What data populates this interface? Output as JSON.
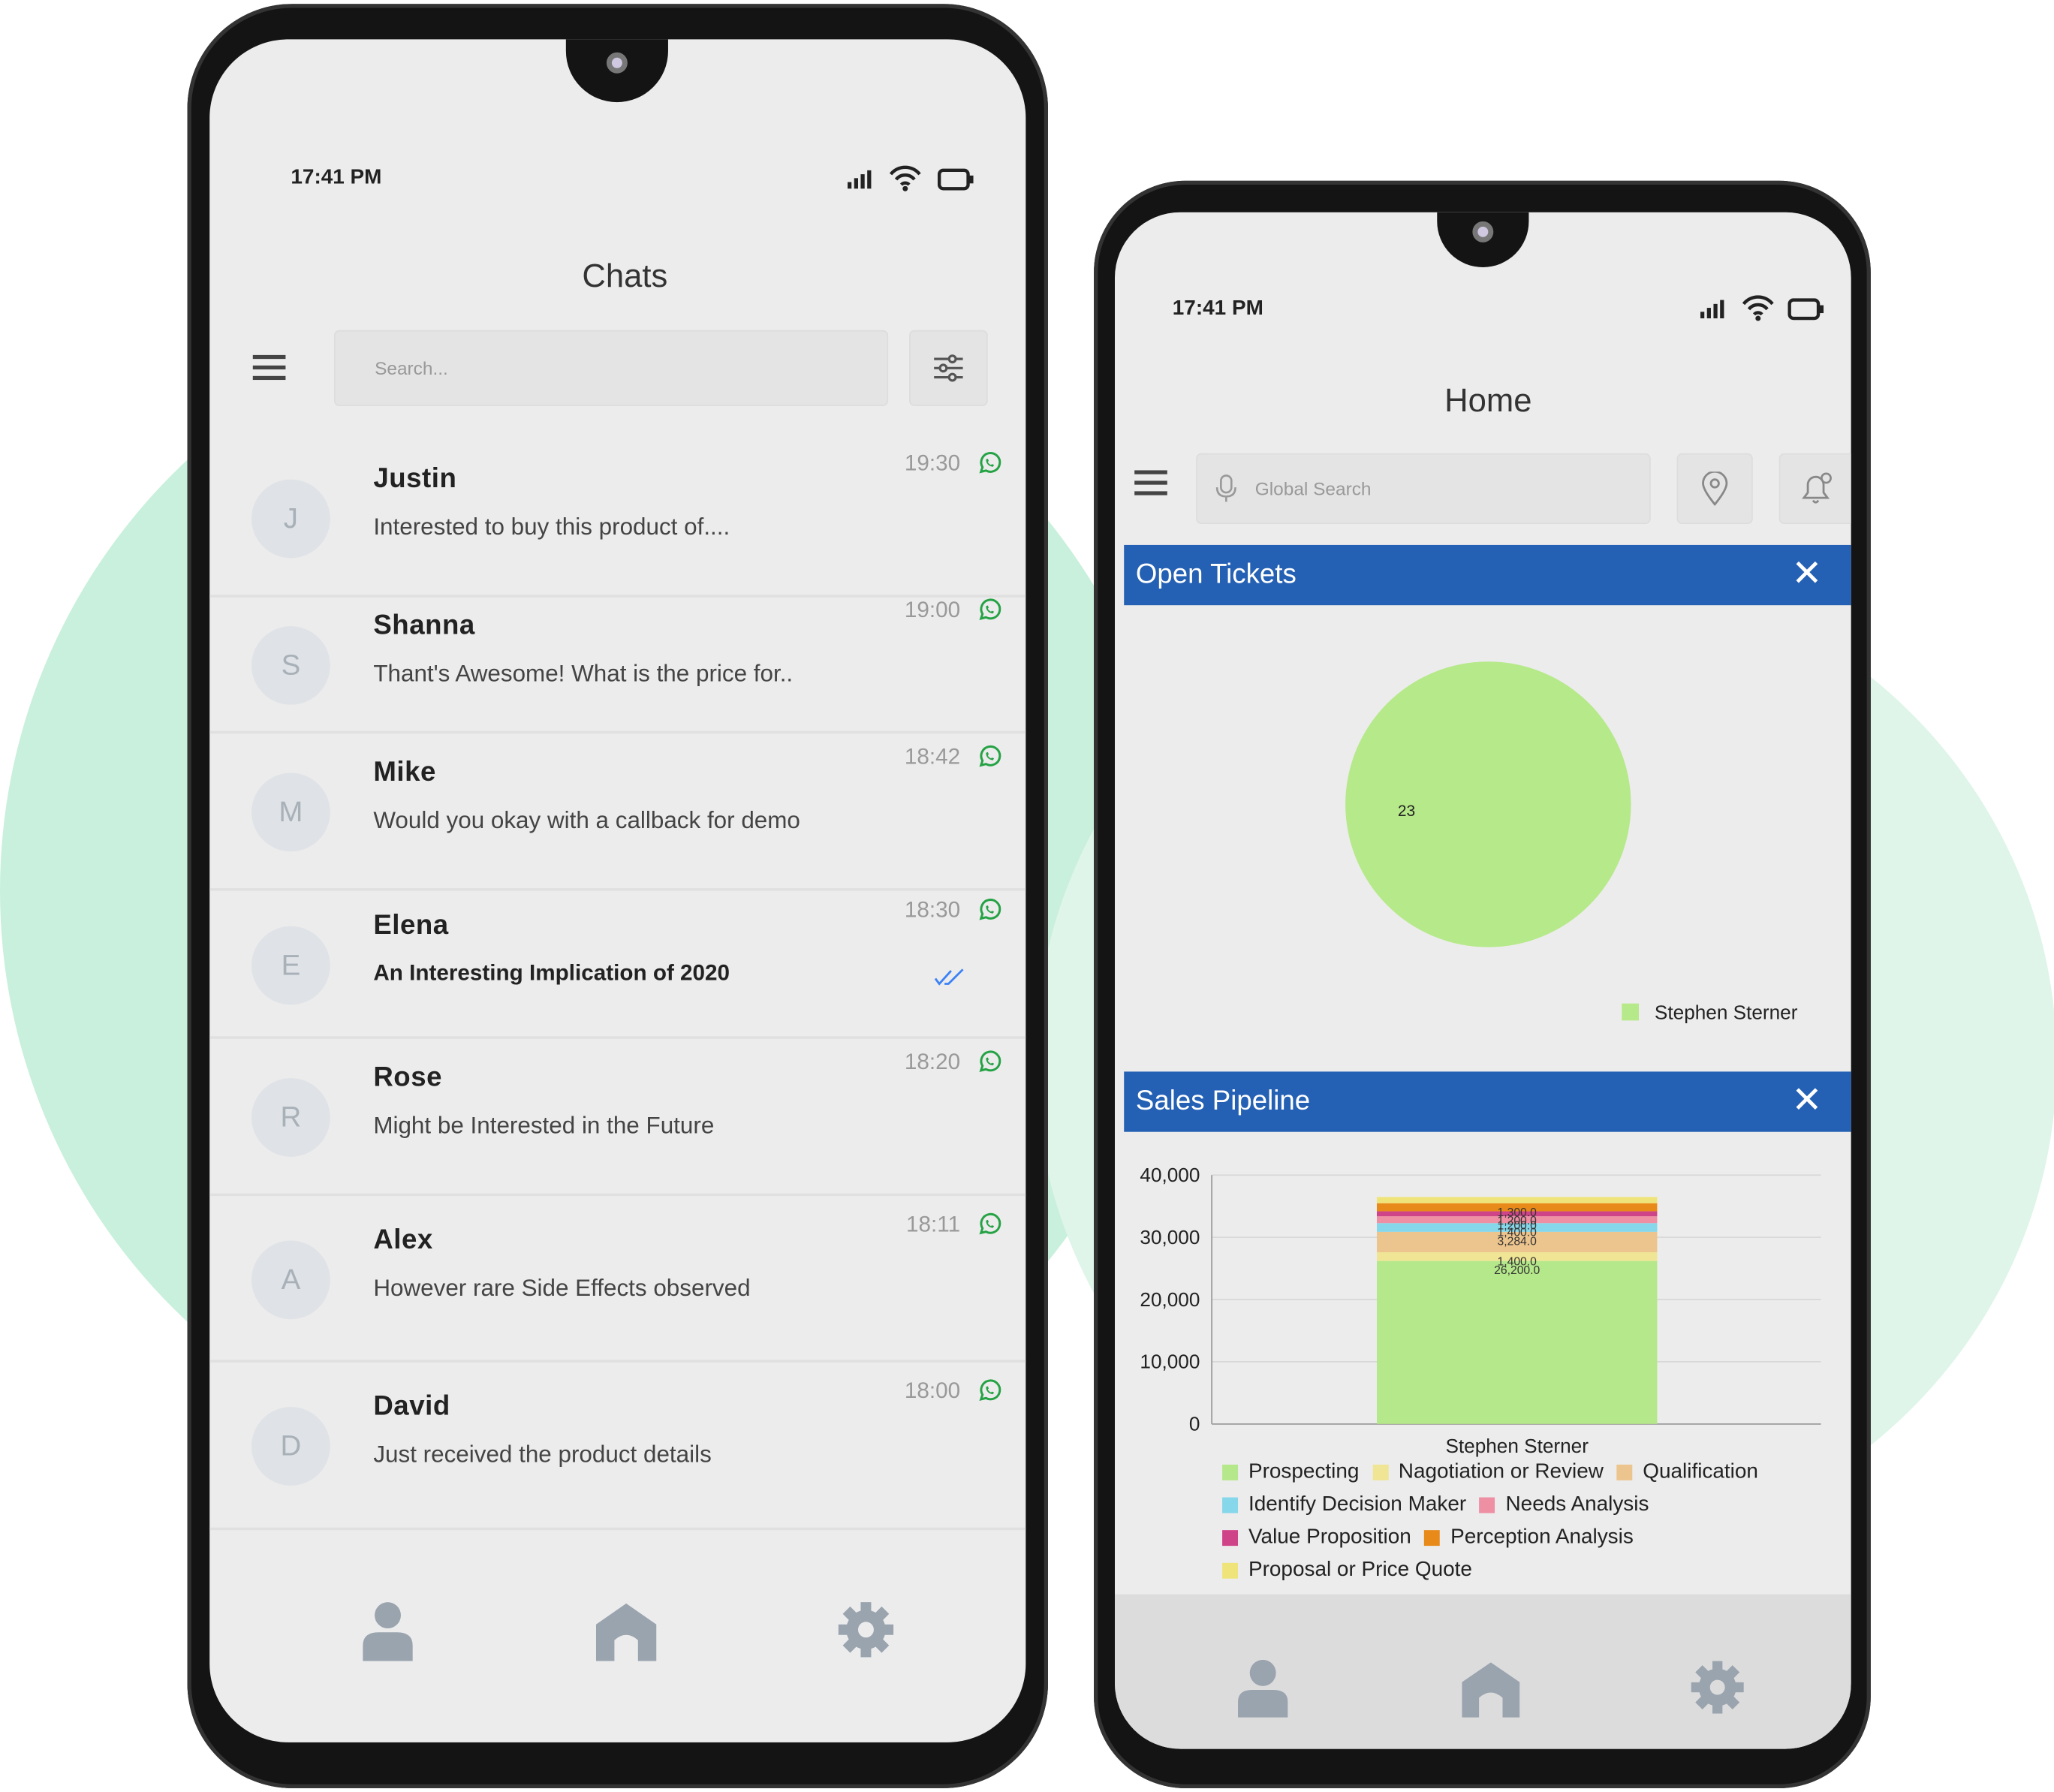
{
  "chats_phone": {
    "status_time": "17:41 PM",
    "title": "Chats",
    "search_placeholder": "Search...",
    "chats": [
      {
        "initial": "J",
        "name": "Justin",
        "message": "Interested to buy this product of....",
        "time": "19:30",
        "read": false
      },
      {
        "initial": "S",
        "name": "Shanna",
        "message": "Thant's Awesome! What is the price for..",
        "time": "19:00",
        "read": false
      },
      {
        "initial": "M",
        "name": "Mike",
        "message": "Would you okay with a callback for demo",
        "time": "18:42",
        "read": false
      },
      {
        "initial": "E",
        "name": "Elena",
        "message": "An Interesting Implication of 2020",
        "time": "18:30",
        "read": true
      },
      {
        "initial": "R",
        "name": "Rose",
        "message": "Might be Interested in the Future",
        "time": "18:20",
        "read": false
      },
      {
        "initial": "A",
        "name": "Alex",
        "message": "However rare Side Effects observed",
        "time": "18:11",
        "read": false
      },
      {
        "initial": "D",
        "name": "David",
        "message": "Just received the product details",
        "time": "18:00",
        "read": false
      }
    ],
    "nav": [
      "user-icon",
      "home-icon",
      "gear-icon"
    ]
  },
  "home_phone": {
    "status_time": "17:41 PM",
    "title": "Home",
    "search_placeholder": "Global Search",
    "open_tickets": {
      "title": "Open Tickets",
      "close": "✕"
    },
    "sales_pipeline": {
      "title": "Sales Pipeline",
      "close": "✕"
    },
    "nav": [
      "user-icon",
      "home-icon",
      "gear-icon"
    ]
  },
  "colors": {
    "accent": "#2460b3",
    "whatsapp": "#25a244",
    "read_ticks": "#3b82f6"
  },
  "chart_data": [
    {
      "type": "pie",
      "slices": [
        {
          "label": "Stephen Sterner",
          "value": 23,
          "color": "#b6e98a"
        }
      ],
      "legend": "bottom-right"
    },
    {
      "type": "bar",
      "stacked": true,
      "categories": [
        "Stephen Sterner"
      ],
      "ylim": [
        0,
        40000
      ],
      "yticks": [
        "0",
        "10,000",
        "20,000",
        "30,000",
        "40,000"
      ],
      "grid": true,
      "legend": "bottom",
      "series": [
        {
          "name": "Prospecting",
          "values": [
            26200
          ],
          "color": "#b5e88a",
          "label": "26,200.0"
        },
        {
          "name": "Nagotiation or Review",
          "values": [
            1400
          ],
          "color": "#f0e594",
          "label": "1,400.0"
        },
        {
          "name": "Qualification",
          "values": [
            3284
          ],
          "color": "#ecc48d",
          "label": "3,284.0"
        },
        {
          "name": "Identify Decision Maker",
          "values": [
            1400
          ],
          "color": "#86d7ea",
          "label": "1,400.0"
        },
        {
          "name": "Needs Analysis",
          "values": [
            1100
          ],
          "color": "#ee8fa4",
          "label": "1,200.0"
        },
        {
          "name": "Value Proposition",
          "values": [
            800
          ],
          "color": "#cf4488",
          "label": "1,200.0"
        },
        {
          "name": "Perception Analysis",
          "values": [
            1300
          ],
          "color": "#e88a1a",
          "label": "1,300.0"
        },
        {
          "name": "Proposal or Price Quote",
          "values": [
            1000
          ],
          "color": "#efe47a",
          "label": ""
        }
      ]
    }
  ]
}
